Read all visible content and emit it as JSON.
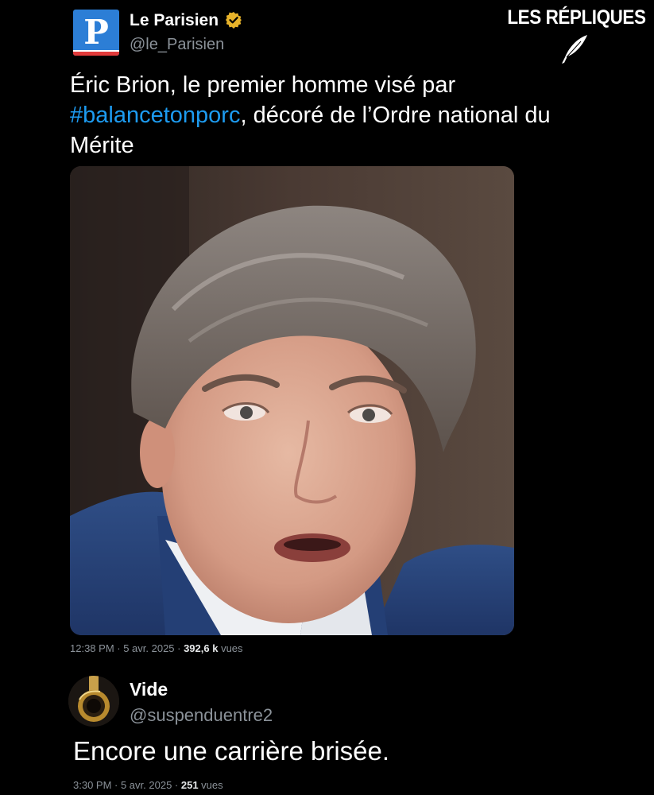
{
  "watermark": {
    "text": "LES RÉPLIQUES"
  },
  "tweet": {
    "author_name": "Le Parisien",
    "handle": "@le_Parisien",
    "avatar_letter": "P",
    "verified": true,
    "text_line1": "Éric Brion, le premier homme visé par",
    "hashtag": "#balancetonporc",
    "text_line2_rest": ", décoré de l’Ordre national du",
    "text_line3": "Mérite",
    "timestamp": "12:38 PM · 5 avr. 2025 · ",
    "views_count": "392,6 k",
    "views_label": " vues"
  },
  "reply": {
    "author_name": "Vide",
    "handle": "@suspenduentre2",
    "text": "Encore une carrière brisée.",
    "timestamp": "3:30 PM · 5 avr. 2025 · ",
    "views_count": "251",
    "views_label": " vues"
  },
  "colors": {
    "background": "#000000",
    "hashtag": "#1d9bf0",
    "muted": "#8b9299",
    "verified_badge": "#e8b32a",
    "brand_blue": "#2c7ed6"
  }
}
